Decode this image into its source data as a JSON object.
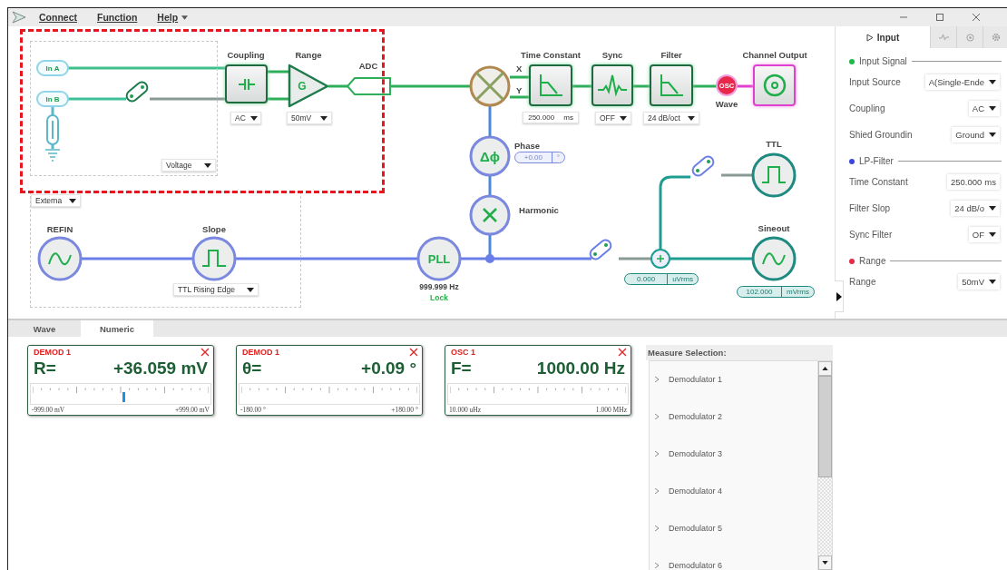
{
  "menu": {
    "items": [
      {
        "label": "Connect",
        "dropdown": false
      },
      {
        "label": "Function",
        "dropdown": false
      },
      {
        "label": "Help",
        "dropdown": true
      }
    ]
  },
  "diagram": {
    "inputs": [
      {
        "label": "In A"
      },
      {
        "label": "In B"
      }
    ],
    "input_mode": "Voltage",
    "coupling": {
      "title": "Coupling",
      "value": "AC"
    },
    "range": {
      "title": "Range",
      "symbol": "G",
      "value": "50mV"
    },
    "adc": {
      "title": "ADC"
    },
    "mixer_outputs": [
      "X",
      "Y"
    ],
    "time_constant": {
      "title": "Time Constant",
      "value": "250.000",
      "unit": "ms"
    },
    "sync": {
      "title": "Sync",
      "value": "OFF"
    },
    "filter": {
      "title": "Filter",
      "value": "24 dB/oct"
    },
    "osc_badge": {
      "label": "OSC",
      "caption": "Wave"
    },
    "channel_output": {
      "title": "Channel Output"
    },
    "phase": {
      "title": "Phase",
      "symbol": "Δϕ",
      "value": "+0.00",
      "unit": "°"
    },
    "harmonic": {
      "title": "Harmonic"
    },
    "pll": {
      "label": "PLL",
      "frequency": "999.999 Hz",
      "status": "Lock"
    },
    "reference": {
      "source": "Externa",
      "title": "REFIN"
    },
    "slope": {
      "title": "Slope",
      "value": "TTL Rising Edge"
    },
    "adder": {
      "value": "0.000",
      "unit": "uVrms"
    },
    "ttl": {
      "title": "TTL"
    },
    "sineout": {
      "title": "Sineout",
      "value": "102.000",
      "unit": "mVrms"
    }
  },
  "right_panel": {
    "tabs": [
      {
        "label": "Input",
        "selected": true
      },
      {
        "selected": false
      },
      {
        "selected": false
      },
      {
        "selected": false
      }
    ],
    "sections": [
      {
        "title": "Input Signal",
        "color": "#1fb84a",
        "rows": [
          {
            "label": "Input Source",
            "kind": "dropdown",
            "value": "A(Single-Ende"
          },
          {
            "label": "Coupling",
            "kind": "dropdown",
            "value": "AC"
          },
          {
            "label": "Shied Groundin",
            "kind": "dropdown",
            "value": "Ground"
          }
        ]
      },
      {
        "title": "LP-Filter",
        "color": "#3b48e0",
        "rows": [
          {
            "label": "Time Constant",
            "kind": "field",
            "value": "250.000",
            "unit": "ms"
          },
          {
            "label": "Filter Slop",
            "kind": "dropdown",
            "value": "24 dB/o"
          },
          {
            "label": "Sync Filter",
            "kind": "dropdown",
            "value": "OF"
          }
        ]
      },
      {
        "title": "Range",
        "color": "#e8284a",
        "rows": [
          {
            "label": "Range",
            "kind": "dropdown",
            "value": "50mV"
          }
        ]
      }
    ]
  },
  "bottom": {
    "tabs": [
      {
        "label": "Wave",
        "selected": false
      },
      {
        "label": "Numeric",
        "selected": true
      }
    ],
    "cards": [
      {
        "title": "DEMOD 1",
        "symbol": "R=",
        "value": "+36.059 mV",
        "min": "-999.00 mV",
        "max": "+999.00 mV",
        "level": 0.51
      },
      {
        "title": "DEMOD 1",
        "symbol": "θ=",
        "value": "+0.09 °",
        "min": "-180.00 °",
        "max": "+180.00 °"
      },
      {
        "title": "OSC 1",
        "symbol": "F=",
        "value": "1000.00 Hz",
        "min": "10.000 uHz",
        "max": "1.000 MHz"
      }
    ],
    "measure_selection": {
      "title": "Measure Selection:",
      "items": [
        "Demodulator 1",
        "Demodulator 2",
        "Demodulator 3",
        "Demodulator 4",
        "Demodulator 5",
        "Demodulator 6"
      ]
    }
  }
}
